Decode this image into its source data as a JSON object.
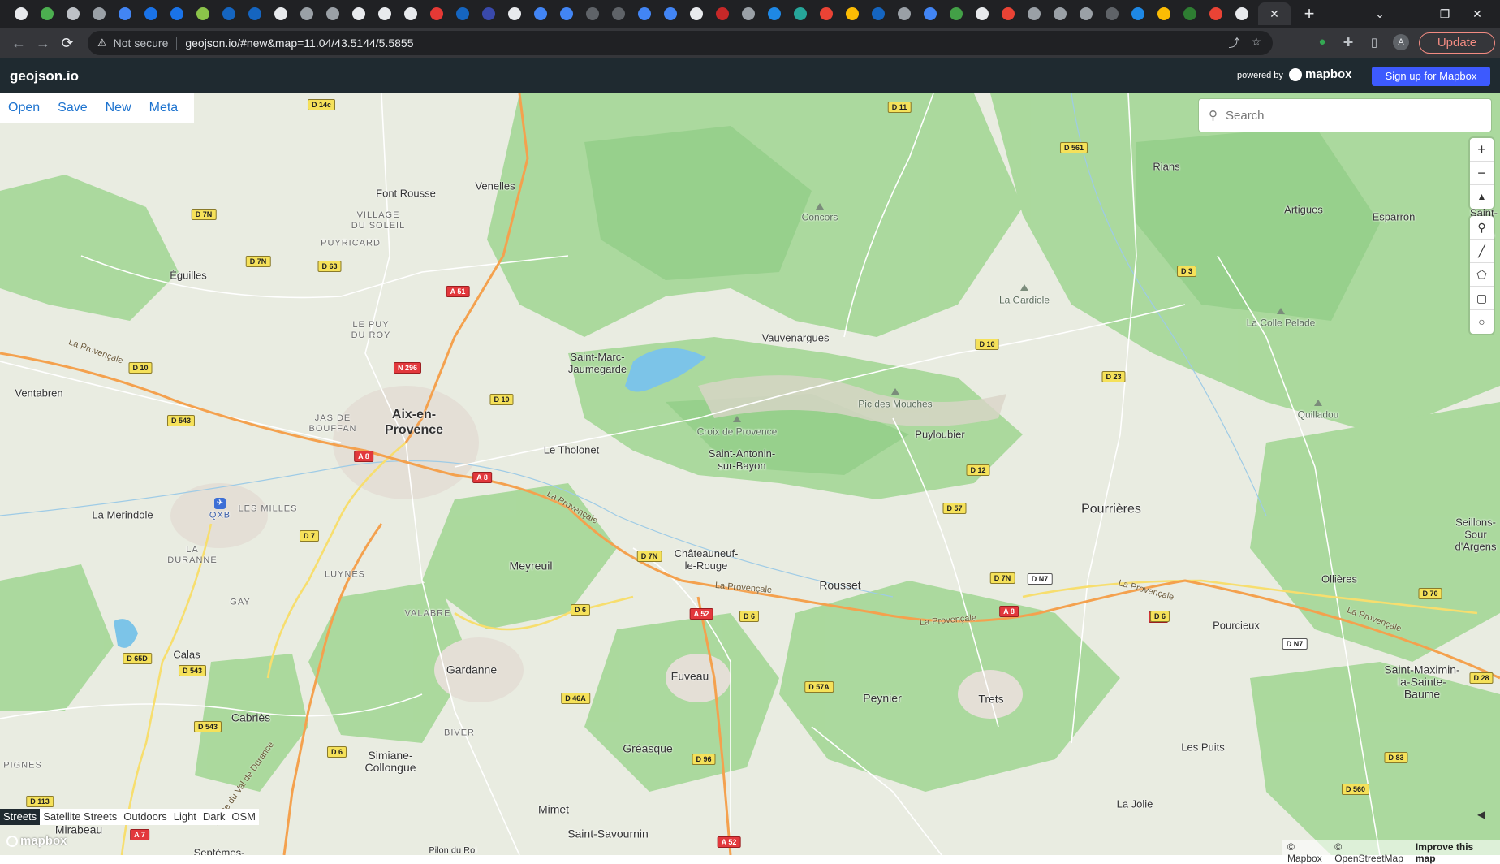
{
  "browser": {
    "tab_count_label": "",
    "active_tab_close": "✕",
    "new_tab": "+",
    "window_controls": [
      "⌄",
      "–",
      "❐",
      "✕"
    ],
    "nav": {
      "back": "←",
      "forward": "→",
      "reload": "⟳"
    },
    "security_label": "Not secure",
    "url": "geojson.io/#new&map=11.04/43.5144/5.5855",
    "update_label": "Update",
    "profile_initial": "A",
    "tab_favicon_colors": [
      "#e8eaed",
      "#4caf50",
      "#bdc1c6",
      "#9aa0a6",
      "#4285f4",
      "#1a73e8",
      "#1a73e8",
      "#8bc34a",
      "#1565c0",
      "#1565c0",
      "#e8eaed",
      "#9aa0a6",
      "#9aa0a6",
      "#e8eaed",
      "#e8eaed",
      "#e8eaed",
      "#e53935",
      "#1565c0",
      "#3949ab",
      "#e8eaed",
      "#4285f4",
      "#4285f4",
      "#5f6368",
      "#5f6368",
      "#4285f4",
      "#4285f4",
      "#e8eaed",
      "#c62828",
      "#9aa0a6",
      "#1e88e5",
      "#26a69a",
      "#ea4335",
      "#fbbc04",
      "#1565c0",
      "#9aa0a6",
      "#4285f4",
      "#43a047",
      "#e8eaed",
      "#ea4335",
      "#9aa0a6",
      "#9aa0a6",
      "#9aa0a6",
      "#5f6368",
      "#1e88e5",
      "#fbbc04",
      "#2e7d32",
      "#ea4335",
      "#e8eaed"
    ]
  },
  "app": {
    "brand": "geojson.io",
    "powered_by": "powered by",
    "mapbox_logo_text": "mapbox",
    "signup_label": "Sign up for Mapbox",
    "file_menu": [
      "Open",
      "Save",
      "New",
      "Meta"
    ],
    "search_placeholder": "Search",
    "zoom": {
      "in": "+",
      "out": "−",
      "compass": "▲"
    },
    "draw_tools": [
      {
        "name": "marker-icon",
        "glyph": "⚲"
      },
      {
        "name": "line-icon",
        "glyph": "╱"
      },
      {
        "name": "polygon-icon",
        "glyph": "⬠"
      },
      {
        "name": "rectangle-icon",
        "glyph": "▢"
      },
      {
        "name": "circle-icon",
        "glyph": "○"
      }
    ],
    "layers": [
      "Streets",
      "Satellite Streets",
      "Outdoors",
      "Light",
      "Dark",
      "OSM"
    ],
    "active_layer": "Streets",
    "attribution": {
      "mapbox": "© Mapbox",
      "osm": "© OpenStreetMap",
      "improve": "Improve this map"
    },
    "collapse_icon": "◀"
  },
  "map": {
    "places": [
      {
        "id": "aix",
        "label": "Aix-en-\nProvence",
        "kind": "big"
      },
      {
        "id": "venelles",
        "label": "Venelles"
      },
      {
        "id": "font-rousse",
        "label": "Font Rousse"
      },
      {
        "id": "eguilles",
        "label": "Éguilles"
      },
      {
        "id": "ventabren",
        "label": "Ventabren"
      },
      {
        "id": "la-merindole",
        "label": "La Merindole"
      },
      {
        "id": "rians",
        "label": "Rians"
      },
      {
        "id": "vauvenargues",
        "label": "Vauvenargues"
      },
      {
        "id": "saint-marc",
        "label": "Saint-Marc-\nJaumegarde"
      },
      {
        "id": "le-tholonet",
        "label": "Le Tholonet"
      },
      {
        "id": "saint-antonin",
        "label": "Saint-Antonin-\nsur-Bayon"
      },
      {
        "id": "puyloubier",
        "label": "Puyloubier"
      },
      {
        "id": "pourrieres",
        "label": "Pourrières"
      },
      {
        "id": "meyreuil",
        "label": "Meyreuil"
      },
      {
        "id": "chateauneuf",
        "label": "Châteauneuf-\nle-Rouge"
      },
      {
        "id": "rousset",
        "label": "Rousset"
      },
      {
        "id": "gardanne",
        "label": "Gardanne"
      },
      {
        "id": "fuveau",
        "label": "Fuveau"
      },
      {
        "id": "peynier",
        "label": "Peynier"
      },
      {
        "id": "trets",
        "label": "Trets"
      },
      {
        "id": "greasque",
        "label": "Gréasque"
      },
      {
        "id": "calas",
        "label": "Calas"
      },
      {
        "id": "cabries",
        "label": "Cabriès"
      },
      {
        "id": "simiane",
        "label": "Simiane-\nCollongue"
      },
      {
        "id": "mimet",
        "label": "Mimet"
      },
      {
        "id": "saint-savournin",
        "label": "Saint-Savournin"
      },
      {
        "id": "mirabeau",
        "label": "Mirabeau"
      },
      {
        "id": "artigues",
        "label": "Artigues"
      },
      {
        "id": "esparron",
        "label": "Esparron"
      },
      {
        "id": "ollieres",
        "label": "Ollières"
      },
      {
        "id": "pourcieux",
        "label": "Pourcieux"
      },
      {
        "id": "saint-maximin",
        "label": "Saint-Maximin-\nla-Sainte-\nBaume"
      },
      {
        "id": "seillons",
        "label": "Seillons-Sour\nd'Argens"
      },
      {
        "id": "saint-martin",
        "label": "Saint-M\nde-P"
      },
      {
        "id": "les-puits",
        "label": "Les Puits"
      },
      {
        "id": "la-jolie",
        "label": "La Jolie"
      },
      {
        "id": "pilon-du-roi",
        "label": "Pilon du Roi"
      },
      {
        "id": "septemes",
        "label": "Septèmes-"
      }
    ],
    "districts": [
      {
        "id": "village-soleil",
        "label": "VILLAGE\nDU SOLEIL"
      },
      {
        "id": "puyricard",
        "label": "PUYRICARD"
      },
      {
        "id": "le-puy-du-roy",
        "label": "LE PUY\nDU ROY"
      },
      {
        "id": "jas-de-bouffan",
        "label": "JAS DE\nBOUFFAN"
      },
      {
        "id": "les-milles",
        "label": "LES MILLES"
      },
      {
        "id": "la-duranne",
        "label": "LA\nDURANNE"
      },
      {
        "id": "luynes",
        "label": "LUYNES"
      },
      {
        "id": "valabre",
        "label": "VALABRE"
      },
      {
        "id": "gay",
        "label": "GAY"
      },
      {
        "id": "biver",
        "label": "BIVER"
      },
      {
        "id": "pignes",
        "label": "PIGNES"
      },
      {
        "id": "qxb",
        "label": "QXB"
      }
    ],
    "peaks": [
      {
        "id": "concors",
        "label": "Concors"
      },
      {
        "id": "la-gardiole",
        "label": "La Gardiole"
      },
      {
        "id": "la-colle-pelade",
        "label": "La Colle Pelade"
      },
      {
        "id": "pic-des-mouches",
        "label": "Pic des Mouches"
      },
      {
        "id": "croix-de-provence",
        "label": "Croix de Provence"
      },
      {
        "id": "quilladou",
        "label": "Quilladou"
      }
    ],
    "road_names": [
      {
        "id": "provencale-w",
        "label": "La Provençale"
      },
      {
        "id": "provencale-c",
        "label": "La Provençale"
      },
      {
        "id": "provencale-m",
        "label": "La Provençale"
      },
      {
        "id": "provencale-e",
        "label": "La Provençale"
      },
      {
        "id": "provencale-e2",
        "label": "La Provençale"
      },
      {
        "id": "provencale-e3",
        "label": "La Provençale"
      },
      {
        "id": "val-durance",
        "label": "Route du Val de Durance"
      }
    ],
    "shields": [
      {
        "label": "D 14c",
        "kind": "d"
      },
      {
        "label": "D 11",
        "kind": "d"
      },
      {
        "label": "D 561",
        "kind": "d"
      },
      {
        "label": "D 7N",
        "kind": "d"
      },
      {
        "label": "D 7N",
        "kind": "d"
      },
      {
        "label": "D 63",
        "kind": "d"
      },
      {
        "label": "A 51",
        "kind": "a"
      },
      {
        "label": "N 296",
        "kind": "a"
      },
      {
        "label": "D 3",
        "kind": "d"
      },
      {
        "label": "D 10",
        "kind": "d"
      },
      {
        "label": "D 10",
        "kind": "d"
      },
      {
        "label": "D 10",
        "kind": "d"
      },
      {
        "label": "D 543",
        "kind": "d"
      },
      {
        "label": "D 23",
        "kind": "d"
      },
      {
        "label": "A 8",
        "kind": "a"
      },
      {
        "label": "A 8",
        "kind": "a"
      },
      {
        "label": "D 12",
        "kind": "d"
      },
      {
        "label": "D 7",
        "kind": "d"
      },
      {
        "label": "D 57",
        "kind": "d"
      },
      {
        "label": "D 7N",
        "kind": "d"
      },
      {
        "label": "A 8",
        "kind": "a"
      },
      {
        "label": "D 7N",
        "kind": "d"
      },
      {
        "label": "D N7",
        "kind": "n"
      },
      {
        "label": "D 6",
        "kind": "d"
      },
      {
        "label": "A 52",
        "kind": "a"
      },
      {
        "label": "D 6",
        "kind": "d"
      },
      {
        "label": "A 8",
        "kind": "a"
      },
      {
        "label": "D 6",
        "kind": "d"
      },
      {
        "label": "D 70",
        "kind": "d"
      },
      {
        "label": "D N7",
        "kind": "n"
      },
      {
        "label": "D 65D",
        "kind": "d"
      },
      {
        "label": "D 543",
        "kind": "d"
      },
      {
        "label": "D 57A",
        "kind": "d"
      },
      {
        "label": "D 46A",
        "kind": "d"
      },
      {
        "label": "D 28",
        "kind": "d"
      },
      {
        "label": "D 543",
        "kind": "d"
      },
      {
        "label": "D 6",
        "kind": "d"
      },
      {
        "label": "D 96",
        "kind": "d"
      },
      {
        "label": "D 83",
        "kind": "d"
      },
      {
        "label": "D 113",
        "kind": "d"
      },
      {
        "label": "D 560",
        "kind": "d"
      },
      {
        "label": "A 7",
        "kind": "a"
      },
      {
        "label": "A 52",
        "kind": "a"
      }
    ]
  }
}
